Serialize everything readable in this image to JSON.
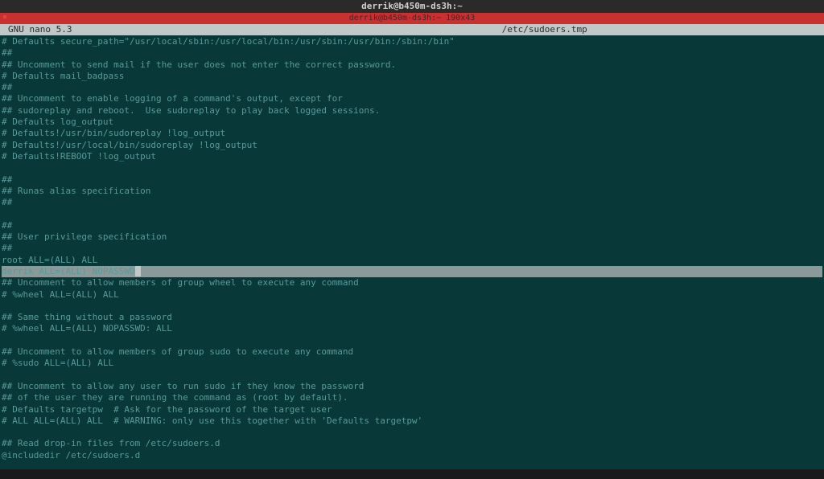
{
  "window": {
    "title": "derrik@b450m-ds3h:~"
  },
  "subtitle": "derrik@b450m-ds3h:~ 190x43",
  "nano": {
    "app_name": "GNU nano 5.3",
    "file_name": "/etc/sudoers.tmp"
  },
  "editor": {
    "lines": [
      "# Defaults secure_path=\"/usr/local/sbin:/usr/local/bin:/usr/sbin:/usr/bin:/sbin:/bin\"",
      "##",
      "## Uncomment to send mail if the user does not enter the correct password.",
      "# Defaults mail_badpass",
      "##",
      "## Uncomment to enable logging of a command's output, except for",
      "## sudoreplay and reboot.  Use sudoreplay to play back logged sessions.",
      "# Defaults log_output",
      "# Defaults!/usr/bin/sudoreplay !log_output",
      "# Defaults!/usr/local/bin/sudoreplay !log_output",
      "# Defaults!REBOOT !log_output",
      "",
      "##",
      "## Runas alias specification",
      "##",
      "",
      "##",
      "## User privilege specification",
      "##",
      "root ALL=(ALL) ALL",
      "derrik ALL=(ALL) NOPASSWD",
      "## Uncomment to allow members of group wheel to execute any command",
      "# %wheel ALL=(ALL) ALL",
      "",
      "## Same thing without a password",
      "# %wheel ALL=(ALL) NOPASSWD: ALL",
      "",
      "## Uncomment to allow members of group sudo to execute any command",
      "# %sudo ALL=(ALL) ALL",
      "",
      "## Uncomment to allow any user to run sudo if they know the password",
      "## of the user they are running the command as (root by default).",
      "# Defaults targetpw  # Ask for the password of the target user",
      "# ALL ALL=(ALL) ALL  # WARNING: only use this together with 'Defaults targetpw'",
      "",
      "## Read drop-in files from /etc/sudoers.d",
      "@includedir /etc/sudoers.d"
    ],
    "highlighted_line_index": 20
  }
}
